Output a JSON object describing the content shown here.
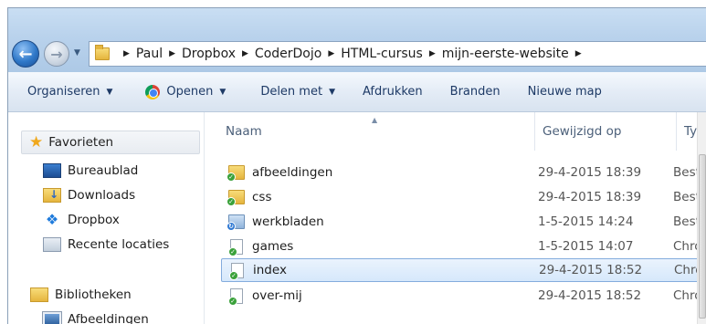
{
  "breadcrumb": [
    "Paul",
    "Dropbox",
    "CoderDojo",
    "HTML-cursus",
    "mijn-eerste-website"
  ],
  "toolbar": {
    "organiseren": "Organiseren",
    "openen": "Openen",
    "delen_met": "Delen met",
    "afdrukken": "Afdrukken",
    "branden": "Branden",
    "nieuwe_map": "Nieuwe map"
  },
  "navpane": {
    "favorites_header": "Favorieten",
    "favorites": [
      "Bureaublad",
      "Downloads",
      "Dropbox",
      "Recente locaties"
    ],
    "libraries_header": "Bibliotheken",
    "libraries": [
      "Afbeeldingen"
    ]
  },
  "columns": {
    "name": "Naam",
    "modified": "Gewijzigd op",
    "type": "Type"
  },
  "files": [
    {
      "name": "afbeeldingen",
      "modified": "29-4-2015 18:39",
      "type": "Besta",
      "kind": "folder",
      "status": "synced"
    },
    {
      "name": "css",
      "modified": "29-4-2015 18:39",
      "type": "Besta",
      "kind": "folder",
      "status": "synced"
    },
    {
      "name": "werkbladen",
      "modified": "1-5-2015 14:24",
      "type": "Besta",
      "kind": "folder",
      "status": "syncing"
    },
    {
      "name": "games",
      "modified": "1-5-2015 14:07",
      "type": "Chro",
      "kind": "file",
      "status": "synced"
    },
    {
      "name": "index",
      "modified": "29-4-2015 18:52",
      "type": "Chro",
      "kind": "file",
      "status": "synced",
      "selected": true
    },
    {
      "name": "over-mij",
      "modified": "29-4-2015 18:52",
      "type": "Chro",
      "kind": "file",
      "status": "synced"
    }
  ]
}
